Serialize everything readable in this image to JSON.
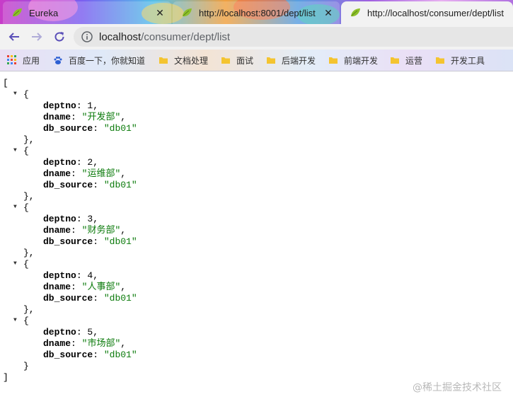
{
  "browser": {
    "tabs": [
      {
        "title": "Eureka",
        "favicon": "spring-leaf-icon",
        "active": false
      },
      {
        "title": "http://localhost:8001/dept/list",
        "favicon": "spring-leaf-icon",
        "active": false
      },
      {
        "title": "http://localhost/consumer/dept/list",
        "favicon": "spring-leaf-icon",
        "active": true
      }
    ],
    "address": {
      "host": "localhost",
      "path": "/consumer/dept/list"
    },
    "bookmarks": [
      {
        "label": "应用",
        "icon": "apps-grid-icon"
      },
      {
        "label": "百度一下，你就知道",
        "icon": "baidu-paw-icon"
      },
      {
        "label": "文档处理",
        "icon": "folder-icon"
      },
      {
        "label": "面试",
        "icon": "folder-icon"
      },
      {
        "label": "后端开发",
        "icon": "folder-icon"
      },
      {
        "label": "前端开发",
        "icon": "folder-icon"
      },
      {
        "label": "运营",
        "icon": "folder-icon"
      },
      {
        "label": "开发工具",
        "icon": "folder-icon"
      }
    ]
  },
  "json_view": {
    "records": [
      {
        "deptno": "1",
        "dname": "开发部",
        "db_source": "db01"
      },
      {
        "deptno": "2",
        "dname": "运维部",
        "db_source": "db01"
      },
      {
        "deptno": "3",
        "dname": "财务部",
        "db_source": "db01"
      },
      {
        "deptno": "4",
        "dname": "人事部",
        "db_source": "db01"
      },
      {
        "deptno": "5",
        "dname": "市场部",
        "db_source": "db01"
      }
    ]
  },
  "watermark": "@稀土掘金技术社区",
  "colors": {
    "string": "#0a7a0a",
    "key": "#000000",
    "accent_tab": "#f2f2f2"
  }
}
